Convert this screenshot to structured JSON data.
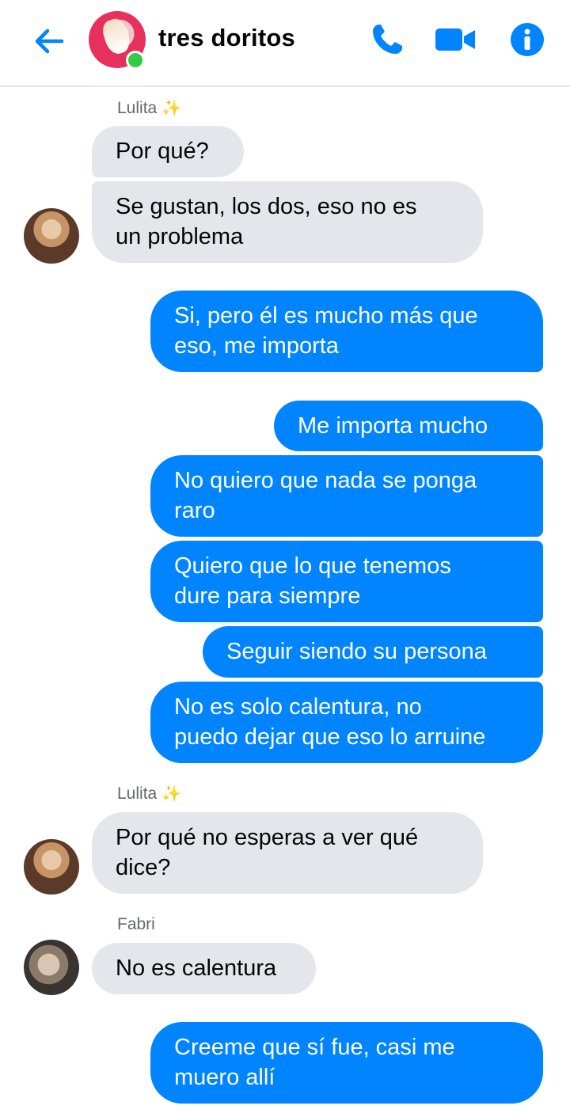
{
  "header": {
    "title": "tres doritos",
    "icons": [
      "back-arrow-icon",
      "phone-icon",
      "video-camera-icon",
      "info-icon"
    ],
    "accent": "#0084ff",
    "online_color": "#31cc46"
  },
  "colors": {
    "incoming": "#e4e6eb",
    "outgoing": "#0084ff"
  },
  "messages": {
    "s1_name": "Lulita",
    "s1_emoji": "✨",
    "m1": "Por qué?",
    "m2a": "Se gustan, los dos, eso no es",
    "m2b": "un problema",
    "m3a": "Si, pero él es mucho más que",
    "m3b": "eso, me importa",
    "m4": "Me importa mucho",
    "m5a": "No quiero que nada se ponga",
    "m5b": "raro",
    "m6a": "Quiero que lo que tenemos",
    "m6b": "dure para siempre",
    "m7": "Seguir siendo su persona",
    "m8a": "No es solo calentura, no",
    "m8b": "puedo dejar que eso lo arruine",
    "s2_name": "Lulita",
    "s2_emoji": "✨",
    "m9a": "Por qué no esperas a ver qué",
    "m9b": "dice?",
    "s3_name": "Fabri",
    "m10": "No es calentura",
    "m11a": "Creeme que sí fue, casi me",
    "m11b": "muero allí"
  }
}
